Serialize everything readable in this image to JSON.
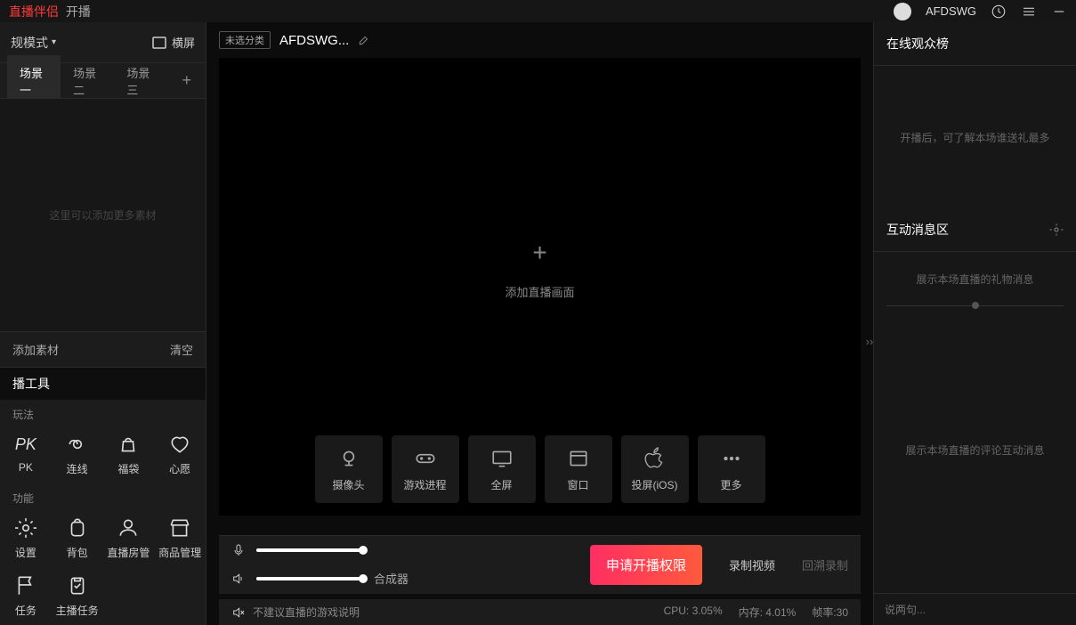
{
  "header": {
    "logo_text": "直播伴侣",
    "sep": "开播",
    "username": "AFDSWG"
  },
  "sidebar": {
    "mode_label": "规模式",
    "landscape_label": "横屏",
    "scenes": [
      "场景一",
      "场景二",
      "场景三"
    ],
    "scene_hint": "这里可以添加更多素材",
    "add_material": "添加素材",
    "clear": "清空",
    "tools_title": "播工具",
    "gameplay_label": "玩法",
    "gameplay": [
      {
        "name": "pk",
        "label": "PK"
      },
      {
        "name": "link",
        "label": "连线"
      },
      {
        "name": "bag",
        "label": "福袋"
      },
      {
        "name": "wish",
        "label": "心愿"
      }
    ],
    "function_label": "功能",
    "functions": [
      {
        "name": "settings",
        "label": "设置"
      },
      {
        "name": "backpack",
        "label": "背包"
      },
      {
        "name": "room-mgmt",
        "label": "直播房管"
      },
      {
        "name": "goods",
        "label": "商品管理"
      },
      {
        "name": "task",
        "label": "任务"
      },
      {
        "name": "anchor-task",
        "label": "主播任务"
      }
    ]
  },
  "center": {
    "tag": "未选分类",
    "title": "AFDSWG...",
    "add_hint": "添加直播画面",
    "sources": [
      {
        "name": "camera",
        "label": "摄像头"
      },
      {
        "name": "game",
        "label": "游戏进程"
      },
      {
        "name": "fullscreen",
        "label": "全屏"
      },
      {
        "name": "window",
        "label": "窗口"
      },
      {
        "name": "ios-cast",
        "label": "投屏(iOS)"
      },
      {
        "name": "more",
        "label": "更多"
      }
    ],
    "synth_label": "合成器",
    "start_button": "申请开播权限",
    "record_button": "录制视频",
    "replay_button": "回溯录制",
    "game_hint": "不建议直播的游戏说明",
    "cpu": "CPU: 3.05%",
    "mem": "内存: 4.01%",
    "fps": "帧率:30"
  },
  "right": {
    "rank_title": "在线观众榜",
    "rank_hint": "开播后，可了解本场谁送礼最多",
    "msg_title": "互动消息区",
    "gift_hint": "展示本场直播的礼物消息",
    "comment_hint": "展示本场直播的评论互动消息",
    "chat_placeholder": "说两句..."
  }
}
